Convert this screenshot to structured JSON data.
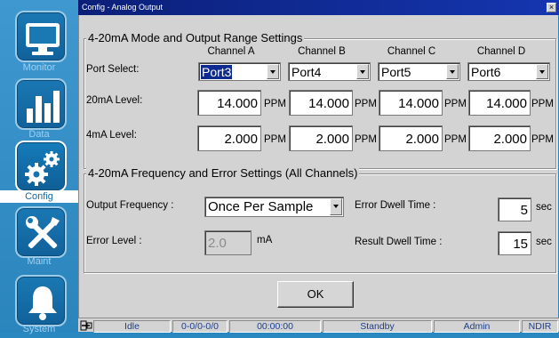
{
  "window": {
    "title": "Config - Analog Output",
    "close_glyph": "×"
  },
  "nav": {
    "items": [
      {
        "label": "Monitor",
        "icon": "monitor-icon"
      },
      {
        "label": "Data",
        "icon": "bar-chart-icon"
      },
      {
        "label": "Config",
        "icon": "gears-icon",
        "active": true
      },
      {
        "label": "Maint",
        "icon": "tools-icon"
      },
      {
        "label": "System",
        "icon": "bell-icon"
      }
    ]
  },
  "mode_group": {
    "title": "4-20mA Mode and Output Range Settings",
    "channels": [
      "Channel  A",
      "Channel  B",
      "Channel  C",
      "Channel  D"
    ],
    "port_label": "Port Select:",
    "level20_label": "20mA Level:",
    "level4_label": "4mA Level:",
    "ports": [
      "Port3",
      "Port4",
      "Port5",
      "Port6"
    ],
    "level20": [
      "14.000",
      "14.000",
      "14.000",
      "14.000"
    ],
    "level4": [
      "2.000",
      "2.000",
      "2.000",
      "2.000"
    ],
    "unit": "PPM"
  },
  "freq_group": {
    "title": "4-20mA Frequency and Error Settings (All Channels)",
    "output_freq_label": "Output Frequency :",
    "output_freq_value": "Once Per Sample",
    "error_level_label": "Error Level :",
    "error_level_value": "2.0",
    "error_level_unit": "mA",
    "error_dwell_label": "Error Dwell Time :",
    "error_dwell_value": "5",
    "result_dwell_label": "Result Dwell Time :",
    "result_dwell_value": "15",
    "sec_unit": "sec"
  },
  "ok_label": "OK",
  "status": {
    "cells": [
      "Idle",
      "0-0/0-0/0",
      "00:00:00",
      "Standby",
      "Admin",
      "NDIR"
    ]
  },
  "colors": {
    "nav_bg": "#2a88c0",
    "title_bar": "#0b1f78",
    "dialog_bg": "#d3d3d3",
    "status_text": "#1c3d8c"
  }
}
